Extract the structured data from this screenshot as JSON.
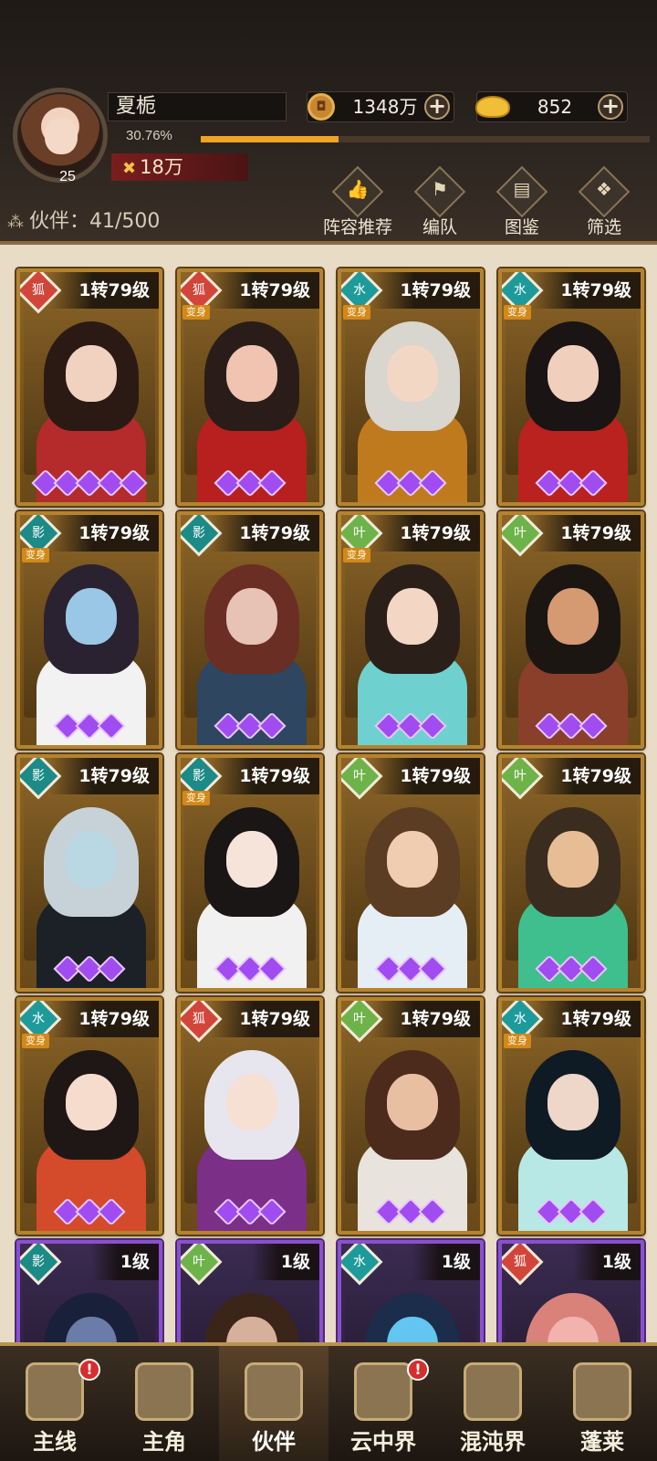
{
  "player": {
    "name": "夏栀",
    "level": "25",
    "exp_percent_text": "30.76%",
    "exp_fraction": 0.3076,
    "power": "18万"
  },
  "currencies": [
    {
      "name": "coin",
      "value": "1348万",
      "icon": "copper-coin-icon"
    },
    {
      "name": "gold",
      "value": "852",
      "icon": "gold-ingot-icon"
    }
  ],
  "partners": {
    "label": "伙伴：",
    "count": "41/500"
  },
  "header_buttons": [
    {
      "label": "阵容推荐",
      "icon": "thumbs-up-icon"
    },
    {
      "label": "编队",
      "icon": "formation-flag-icon"
    },
    {
      "label": "图鉴",
      "icon": "scroll-icon"
    },
    {
      "label": "筛选",
      "icon": "filter-icon"
    }
  ],
  "colors": {
    "gold_border": "#b4832f",
    "purple_border": "#8b4fd1",
    "star_purple": "#a14cf0",
    "exp_fill": "#f1a323",
    "fire": "#d2453a",
    "water": "#1f9a9a",
    "wood": "#6db34a",
    "dark": "#1c8a86"
  },
  "transform_badge": "变身",
  "cards": [
    {
      "level": "1转79级",
      "element": "fire",
      "transform": false,
      "stars": 5,
      "rarity": "gold",
      "hair": "#2b1a14",
      "skin": "#f1d2c0",
      "outfit": "#b52a2a"
    },
    {
      "level": "1转79级",
      "element": "fire",
      "transform": true,
      "stars": 3,
      "rarity": "gold",
      "hair": "#2a1d19",
      "skin": "#f0c4b0",
      "outfit": "#b81f1f"
    },
    {
      "level": "1转79级",
      "element": "water",
      "transform": true,
      "stars": 3,
      "rarity": "gold",
      "hair": "#d9d5cf",
      "skin": "#f2d7c5",
      "outfit": "#c07a1e"
    },
    {
      "level": "1转79级",
      "element": "water",
      "transform": true,
      "stars": 3,
      "rarity": "gold",
      "hair": "#1a1414",
      "skin": "#f1cfbd",
      "outfit": "#b9221e"
    },
    {
      "level": "1转79级",
      "element": "dark",
      "transform": true,
      "stars": 3,
      "rarity": "gold",
      "hair": "#2a2230",
      "skin": "#9bc7e6",
      "outfit": "#f2f2f2"
    },
    {
      "level": "1转79级",
      "element": "dark",
      "transform": false,
      "stars": 3,
      "rarity": "gold",
      "hair": "#6a2e25",
      "skin": "#e6c3b5",
      "outfit": "#2e4660"
    },
    {
      "level": "1转79级",
      "element": "wood",
      "transform": true,
      "stars": 3,
      "rarity": "gold",
      "hair": "#2b1f1a",
      "skin": "#f3d6c4",
      "outfit": "#6fd0d0"
    },
    {
      "level": "1转79级",
      "element": "wood",
      "transform": false,
      "stars": 3,
      "rarity": "gold",
      "hair": "#1c1613",
      "skin": "#d69a72",
      "outfit": "#8a3f2a"
    },
    {
      "level": "1转79级",
      "element": "dark",
      "transform": false,
      "stars": 3,
      "rarity": "gold",
      "hair": "#c6d2d8",
      "skin": "#b9d8e3",
      "outfit": "#1b2126"
    },
    {
      "level": "1转79级",
      "element": "dark",
      "transform": true,
      "stars": 3,
      "rarity": "gold",
      "hair": "#1a1616",
      "skin": "#f6e4da",
      "outfit": "#f1f1f1"
    },
    {
      "level": "1转79级",
      "element": "wood",
      "transform": false,
      "stars": 3,
      "rarity": "gold",
      "hair": "#5a3d22",
      "skin": "#f0ccb0",
      "outfit": "#e5eef5"
    },
    {
      "level": "1转79级",
      "element": "wood",
      "transform": false,
      "stars": 3,
      "rarity": "gold",
      "hair": "#3a2d1f",
      "skin": "#e6bd95",
      "outfit": "#3fbf8d"
    },
    {
      "level": "1转79级",
      "element": "water",
      "transform": true,
      "stars": 3,
      "rarity": "gold",
      "hair": "#1f1715",
      "skin": "#f5dccd",
      "outfit": "#d34b2a"
    },
    {
      "level": "1转79级",
      "element": "fire",
      "transform": false,
      "stars": 3,
      "rarity": "gold",
      "hair": "#e7e6ef",
      "skin": "#f6dfd3",
      "outfit": "#7b2f86"
    },
    {
      "level": "1转79级",
      "element": "wood",
      "transform": false,
      "stars": 3,
      "rarity": "gold",
      "hair": "#4c2b1d",
      "skin": "#e8bfa1",
      "outfit": "#e8e4dd"
    },
    {
      "level": "1转79级",
      "element": "water",
      "transform": true,
      "stars": 3,
      "rarity": "gold",
      "hair": "#0f1b24",
      "skin": "#eed6c8",
      "outfit": "#b7e8e6"
    },
    {
      "level": "1级",
      "element": "dark",
      "transform": false,
      "stars": 0,
      "rarity": "purple",
      "hair": "#18203a",
      "skin": "#6a7ca8",
      "outfit": "#2c2a40"
    },
    {
      "level": "1级",
      "element": "wood",
      "transform": false,
      "stars": 0,
      "rarity": "purple",
      "hair": "#3a2518",
      "skin": "#d7b09b",
      "outfit": "#4a3a2e"
    },
    {
      "level": "1级",
      "element": "water",
      "transform": false,
      "stars": 0,
      "rarity": "purple",
      "hair": "#1b2d4a",
      "skin": "#63c6f0",
      "outfit": "#2a3c78"
    },
    {
      "level": "1级",
      "element": "fire",
      "transform": false,
      "stars": 0,
      "rarity": "purple",
      "hair": "#d8827a",
      "skin": "#f2b2ad",
      "outfit": "#b9504c"
    }
  ],
  "nav": [
    {
      "label": "主线",
      "icon": "crossed-swords-icon",
      "alert": true,
      "active": false
    },
    {
      "label": "主角",
      "icon": "hero-portrait-icon",
      "alert": false,
      "active": false
    },
    {
      "label": "伙伴",
      "icon": "partner-crown-icon",
      "alert": false,
      "active": true
    },
    {
      "label": "云中界",
      "icon": "cloud-pavilion-icon",
      "alert": true,
      "active": false
    },
    {
      "label": "混沌界",
      "icon": "chaos-statue-icon",
      "alert": false,
      "active": false
    },
    {
      "label": "蓬莱",
      "icon": "immortal-sage-icon",
      "alert": false,
      "active": false
    }
  ]
}
